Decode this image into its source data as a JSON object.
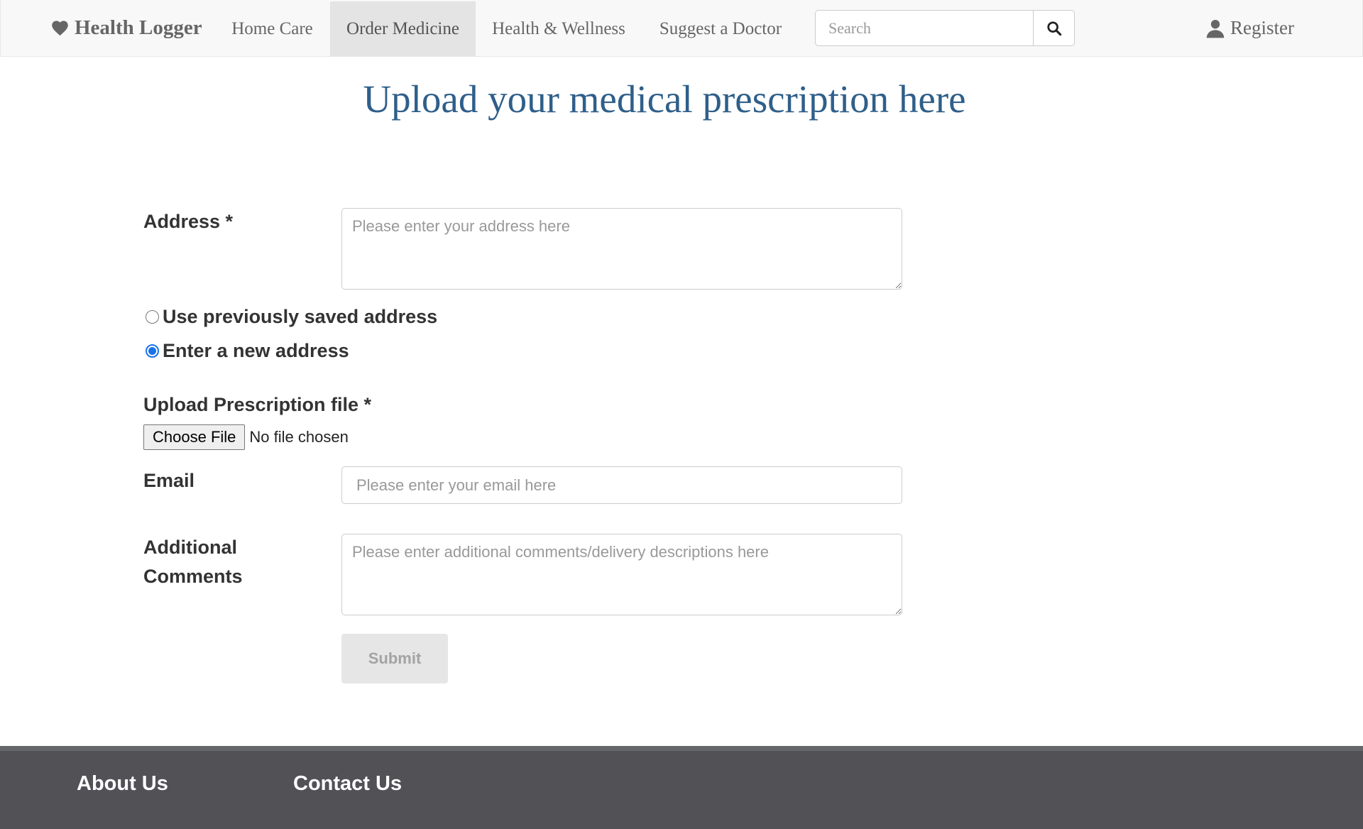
{
  "navbar": {
    "brand": "Health Logger",
    "brand_icon": "heart-icon",
    "items": [
      {
        "label": "Home Care",
        "active": false
      },
      {
        "label": "Order Medicine",
        "active": true
      },
      {
        "label": "Health & Wellness",
        "active": false
      },
      {
        "label": "Suggest a Doctor",
        "active": false
      }
    ],
    "search": {
      "placeholder": "Search",
      "value": "",
      "icon": "search-icon"
    },
    "register": {
      "label": "Register",
      "icon": "user-icon"
    }
  },
  "page": {
    "title": "Upload your medical prescription here"
  },
  "form": {
    "address": {
      "label": "Address *",
      "placeholder": "Please enter your address here",
      "value": ""
    },
    "address_options": [
      {
        "label": "Use previously saved address",
        "checked": false
      },
      {
        "label": "Enter a new address",
        "checked": true
      }
    ],
    "prescription": {
      "label": "Upload Prescription file *",
      "button_label": "Choose File",
      "status": "No file chosen"
    },
    "email": {
      "label": "Email",
      "placeholder": "Please enter your email here",
      "value": ""
    },
    "comments": {
      "label_line1": "Additional",
      "label_line2": "Comments",
      "placeholder": "Please enter additional comments/delivery descriptions here",
      "value": ""
    },
    "submit_label": "Submit",
    "submit_enabled": false
  },
  "footer": {
    "about": "About Us",
    "contact": "Contact Us"
  },
  "colors": {
    "title": "#2f5f8a",
    "navbar_bg": "#f8f8f8",
    "nav_active_bg": "#e4e4e4",
    "footer_bg": "#515156",
    "radio_accent": "#1a73e8"
  }
}
